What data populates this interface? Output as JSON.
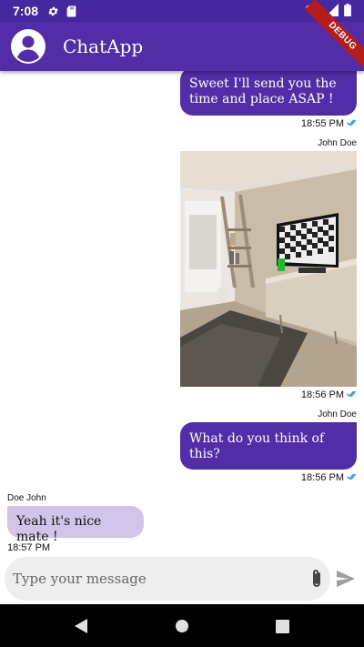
{
  "status_bar": {
    "time": "7:08",
    "icons": [
      "gear-icon",
      "sd-card-icon",
      "wifi-icon",
      "signal-icon",
      "battery-icon"
    ]
  },
  "app_bar": {
    "title": "ChatApp",
    "avatar_icon": "account-circle-icon",
    "debug_label": "DEBUG"
  },
  "messages": [
    {
      "direction": "outgoing",
      "text": "Sweet I'll send you the time and place ASAP !",
      "time": "18:55 PM",
      "read_icon": "double-check-icon"
    },
    {
      "direction": "outgoing",
      "sender": "John Doe",
      "type": "image",
      "image_icon": "living-room-photo",
      "time": "18:56 PM",
      "read_icon": "double-check-icon"
    },
    {
      "direction": "outgoing",
      "sender": "John Doe",
      "text": "What do you think of this?",
      "time": "18:56 PM",
      "read_icon": "double-check-icon"
    },
    {
      "direction": "incoming",
      "sender": "Doe John",
      "text": "Yeah it's nice mate !",
      "time": "18:57 PM"
    }
  ],
  "composer": {
    "placeholder": "Type your message",
    "value": "",
    "attach_icon": "paperclip-icon",
    "send_icon": "send-icon"
  },
  "nav_bar": {
    "icons": [
      "back-icon",
      "home-icon",
      "recents-icon"
    ]
  },
  "colors": {
    "status_bar": "#4527a0",
    "app_bar": "#512da8",
    "outgoing_bubble": "#512da8",
    "incoming_bubble": "#d1c4e9",
    "read_check": "#2196f3",
    "composer_bg": "#eeeeee",
    "debug_banner": "#b71c1c"
  }
}
